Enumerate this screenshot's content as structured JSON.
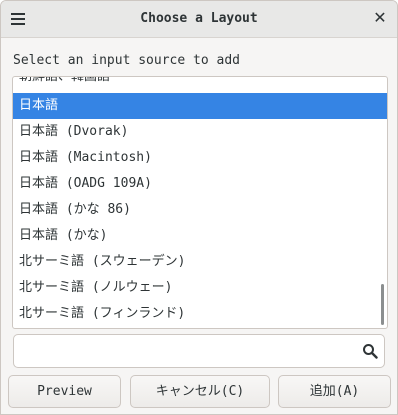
{
  "window": {
    "title": "Choose a Layout",
    "menu_icon": "hamburger-menu-icon",
    "close_icon": "close-icon",
    "close_glyph": "✕"
  },
  "prompt": "Select an input source to add",
  "list": {
    "selected_index": 1,
    "items": [
      "朝鮮語、韓国語",
      "日本語",
      "日本語 (Dvorak)",
      "日本語 (Macintosh)",
      "日本語 (OADG 109A)",
      "日本語 (かな 86)",
      "日本語 (かな)",
      "北サーミ語 (スウェーデン)",
      "北サーミ語 (ノルウェー)",
      "北サーミ語 (フィンランド)"
    ]
  },
  "search": {
    "value": "",
    "icon": "search-icon"
  },
  "buttons": {
    "preview": "Preview",
    "cancel": "キャンセル(C)",
    "add": "追加(A)"
  }
}
